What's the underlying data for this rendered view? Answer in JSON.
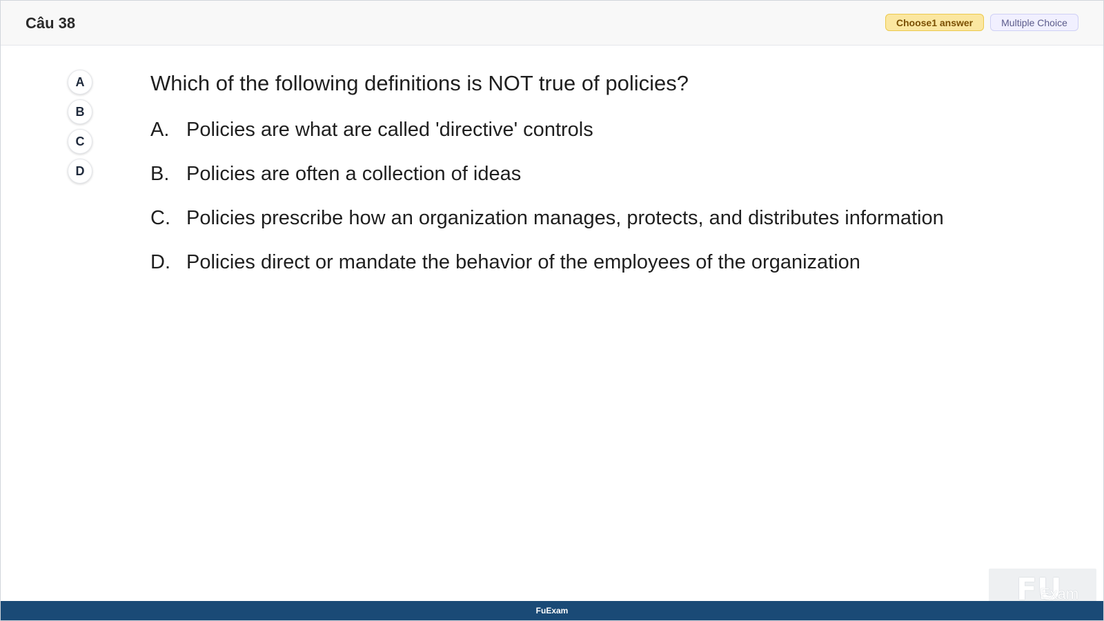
{
  "header": {
    "question_number": "Câu 38",
    "choose_badge": "Choose1 answer",
    "type_badge": "Multiple Choice"
  },
  "selectors": [
    "A",
    "B",
    "C",
    "D"
  ],
  "question": {
    "text": "Which of the following definitions is NOT true of policies?",
    "options": [
      {
        "letter": "A.",
        "text": "Policies are what are called 'directive' controls"
      },
      {
        "letter": "B.",
        "text": "Policies are often a collection of ideas"
      },
      {
        "letter": "C.",
        "text": "Policies prescribe how an organization manages, protects, and distributes information"
      },
      {
        "letter": "D.",
        "text": "Policies direct or mandate the behavior of the employees of the organization"
      }
    ]
  },
  "watermark": {
    "mark": "FU",
    "text": "Exam"
  },
  "footer": {
    "brand": "FuExam"
  },
  "colors": {
    "footer_bg": "#1a4a76",
    "choose_badge_bg": "#fbe7a1",
    "type_badge_bg": "#f1f0ff"
  }
}
